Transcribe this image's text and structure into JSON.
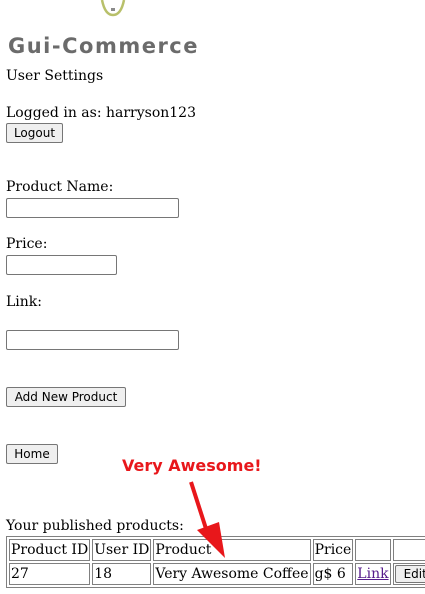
{
  "header": {
    "logo_text": "Gui-Commerce",
    "page_heading": "User Settings"
  },
  "session": {
    "logged_in_text": "Logged in as: harryson123",
    "logout_label": "Logout"
  },
  "form": {
    "product_name_label": "Product Name:",
    "price_label": "Price:",
    "link_label": "Link:",
    "product_name_value": "",
    "price_value": "",
    "link_value": "",
    "add_button_label": "Add New Product"
  },
  "nav": {
    "home_label": "Home"
  },
  "annotation": {
    "text": "Very Awesome!",
    "color": "#e8171b"
  },
  "products": {
    "caption": "Your published products:",
    "columns": [
      "Product ID",
      "User ID",
      "Product",
      "Price",
      "",
      ""
    ],
    "rows": [
      {
        "product_id": "27",
        "user_id": "18",
        "product": "Very Awesome Coffee",
        "price": "g$ 6",
        "link_label": "Link",
        "edit_label": "Edit"
      }
    ]
  }
}
